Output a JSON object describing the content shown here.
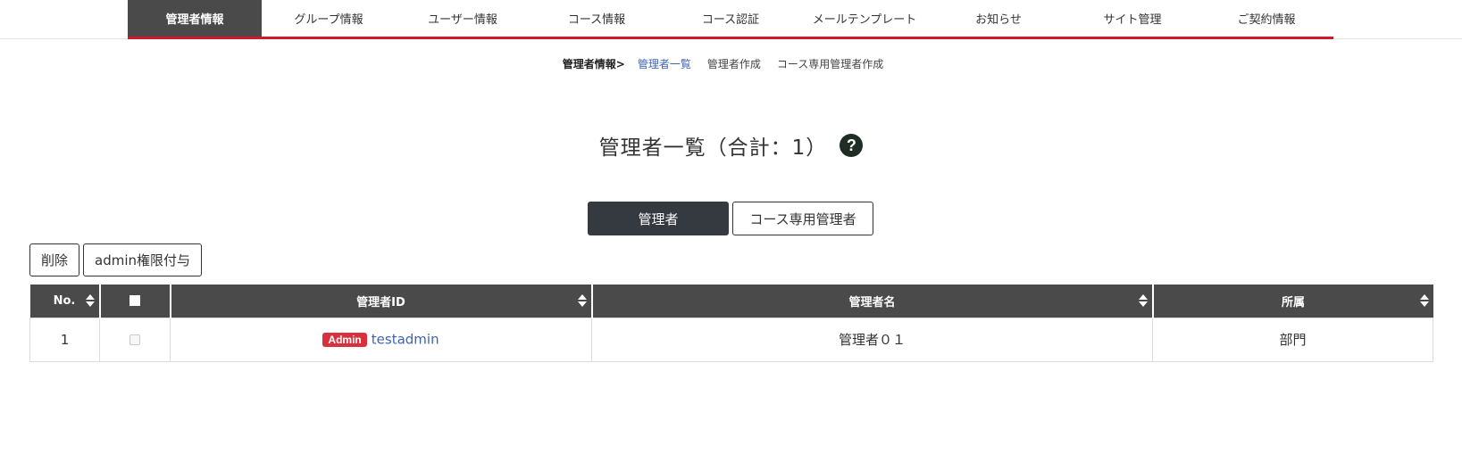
{
  "topnav": {
    "items": [
      {
        "label": "管理者情報",
        "active": true
      },
      {
        "label": "グループ情報",
        "active": false
      },
      {
        "label": "ユーザー情報",
        "active": false
      },
      {
        "label": "コース情報",
        "active": false
      },
      {
        "label": "コース認証",
        "active": false
      },
      {
        "label": "メールテンプレート",
        "active": false
      },
      {
        "label": "お知らせ",
        "active": false
      },
      {
        "label": "サイト管理",
        "active": false
      },
      {
        "label": "ご契約情報",
        "active": false
      }
    ],
    "accent_color": "#d0192b"
  },
  "subnav": {
    "current": "管理者情報>",
    "items": [
      "管理者一覧",
      "管理者作成",
      "コース専用管理者作成"
    ]
  },
  "page": {
    "title": "管理者一覧（合計：1）",
    "help_icon_glyph": "?"
  },
  "tabs": {
    "admin": "管理者",
    "course_admin": "コース専用管理者"
  },
  "actions": {
    "delete": "削除",
    "grant_admin": "admin権限付与"
  },
  "table": {
    "columns": {
      "no": "No.",
      "admin_id": "管理者ID",
      "admin_name": "管理者名",
      "department": "所属"
    },
    "rows": [
      {
        "no": "1",
        "badge": "Admin",
        "admin_id": "testadmin",
        "admin_name": "管理者０１",
        "department": "部門"
      }
    ]
  },
  "colors": {
    "header_bg": "#4a4a4a",
    "badge_bg": "#d9303e",
    "link": "#3b63b8",
    "active_tab_bg": "#343a40"
  }
}
